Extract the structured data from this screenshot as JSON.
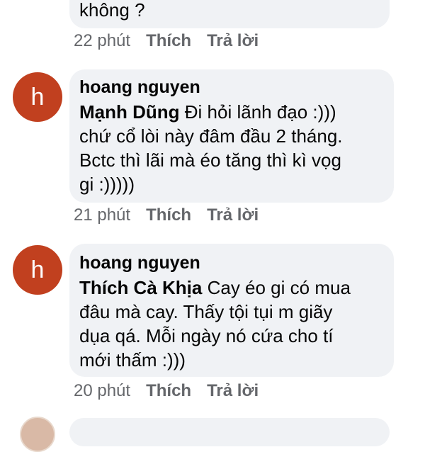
{
  "comment_top": {
    "text_tail": "không ?",
    "time": "22 phút",
    "like_label": "Thích",
    "reply_label": "Trả lời"
  },
  "comment_1": {
    "avatar_letter": "h",
    "author": "hoang nguyen",
    "mention": "Mạnh Dũng",
    "line1_rest": " Đi hỏi lãnh đạo :)))",
    "line2": "chứ cổ lòi này đâm đầu 2 tháng.",
    "line3": "Bctc thì lãi mà éo tăng thì kì vọg",
    "line4": "gi :)))))",
    "time": "21 phút",
    "like_label": "Thích",
    "reply_label": "Trả lời"
  },
  "comment_2": {
    "avatar_letter": "h",
    "author": "hoang nguyen",
    "mention": "Thích Cà Khịa",
    "line1_rest": " Cay éo gi có mua",
    "line2": "đâu mà cay. Thấy tội tụi m giãy",
    "line3": "dụa qá. Mỗi ngày nó cứa cho tí",
    "line4": "mới thấm :)))",
    "time": "20 phút",
    "like_label": "Thích",
    "reply_label": "Trả lời"
  },
  "colors": {
    "bubble_bg": "#f0f2f5",
    "avatar_bg": "#c1401f",
    "meta_text": "#65676b",
    "body_text": "#050505"
  }
}
